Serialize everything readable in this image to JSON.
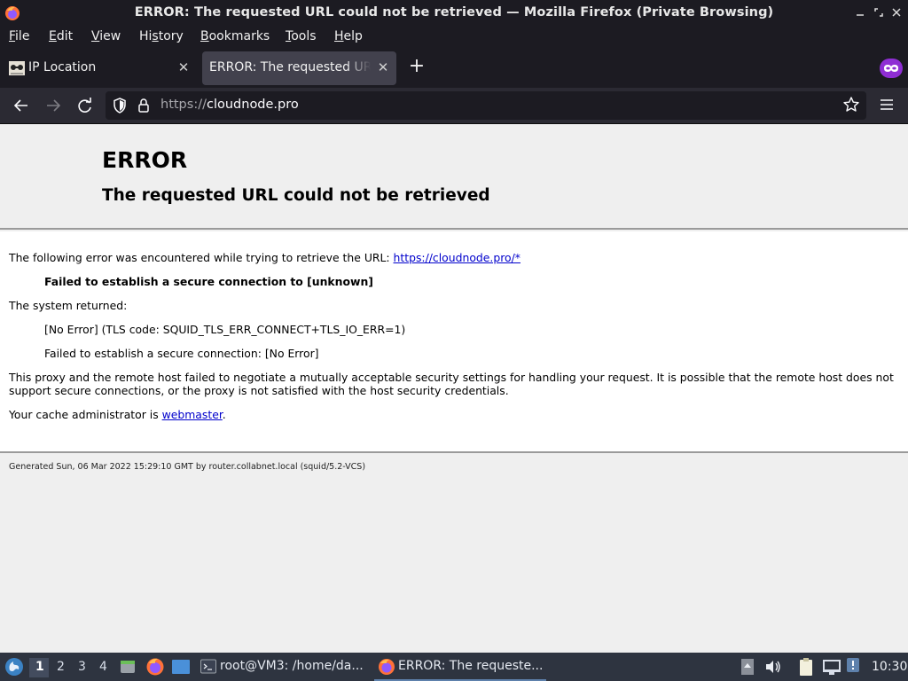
{
  "window": {
    "title": "ERROR: The requested URL could not be retrieved — Mozilla Firefox (Private Browsing)"
  },
  "menubar": {
    "items": [
      {
        "label": "File",
        "mnemonic": "F",
        "rest": "ile"
      },
      {
        "label": "Edit",
        "mnemonic": "E",
        "rest": "dit"
      },
      {
        "label": "View",
        "mnemonic": "V",
        "rest": "iew"
      },
      {
        "label": "History",
        "mnemonic": "s",
        "pre": "Hi",
        "rest": "tory"
      },
      {
        "label": "Bookmarks",
        "mnemonic": "B",
        "rest": "ookmarks"
      },
      {
        "label": "Tools",
        "mnemonic": "T",
        "rest": "ools"
      },
      {
        "label": "Help",
        "mnemonic": "H",
        "rest": "elp"
      }
    ]
  },
  "tabs": [
    {
      "label": "IP Location",
      "active": false
    },
    {
      "label": "ERROR: The requested URL could not be retrieved",
      "active": true
    }
  ],
  "navbar": {
    "url_scheme": "https://",
    "url_host": "cloudnode.pro"
  },
  "page": {
    "h1": "ERROR",
    "h2": "The requested URL could not be retrieved",
    "intro": "The following error was encountered while trying to retrieve the URL: ",
    "intro_link": "https://cloudnode.pro/*",
    "error_bold": "Failed to establish a secure connection to [unknown]",
    "system_returned": "The system returned:",
    "sys_line1": "[No Error] (TLS code: SQUID_TLS_ERR_CONNECT+TLS_IO_ERR=1)",
    "sys_line2": "Failed to establish a secure connection: [No Error]",
    "explain": "This proxy and the remote host failed to negotiate a mutually acceptable security settings for handling your request. It is possible that the remote host does not support secure connections, or the proxy is not satisfied with the host security credentials.",
    "admin_prefix": "Your cache administrator is ",
    "admin_link": "webmaster",
    "admin_suffix": ".",
    "footer": "Generated Sun, 06 Mar 2022 15:29:10 GMT by router.collabnet.local (squid/5.2-VCS)"
  },
  "taskbar": {
    "workspaces": [
      "1",
      "2",
      "3",
      "4"
    ],
    "current_workspace": "1",
    "tasks": [
      {
        "label": "root@VM3: /home/da...",
        "icon": "terminal-icon"
      },
      {
        "label": "ERROR: The requeste...",
        "icon": "firefox-icon",
        "active": true
      }
    ],
    "clock": "10:30"
  },
  "colors": {
    "chrome_dark": "#1c1b22",
    "navbar_bg": "#2b2a33",
    "active_tab": "#42414d",
    "private_purple": "#8f2ed4",
    "link": "#0000cc",
    "taskbar_bg": "#2e3440"
  }
}
